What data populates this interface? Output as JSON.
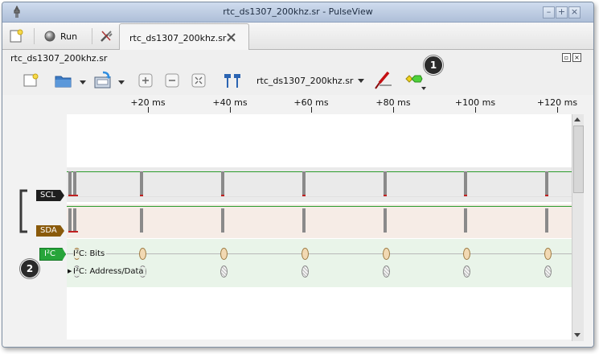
{
  "window": {
    "title": "rtc_ds1307_200khz.sr - PulseView"
  },
  "tabbar": {
    "run_label": "Run",
    "tab_label": "rtc_ds1307_200khz.sr"
  },
  "session": {
    "label": "rtc_ds1307_200khz.sr"
  },
  "toolbar": {
    "device_label": "rtc_ds1307_200khz.sr"
  },
  "ruler": {
    "ticks": [
      "+20 ms",
      "+40 ms",
      "+60 ms",
      "+80 ms",
      "+100 ms",
      "+120 ms"
    ]
  },
  "signals": {
    "scl": {
      "name": "SCL",
      "color": "#1e1e1e"
    },
    "sda": {
      "name": "SDA",
      "color": "#8a5a0b"
    },
    "decoder": {
      "name": "I²C",
      "color": "#27a53a"
    }
  },
  "decoder_rows": {
    "bits": "I²C: Bits",
    "address_data": "I²C: Address/Data"
  },
  "callouts": {
    "one": "1",
    "two": "2"
  },
  "icons": [
    "new-icon",
    "settings-icon",
    "close-icon",
    "open-icon",
    "save-icon",
    "zoom-in-icon",
    "zoom-out-icon",
    "zoom-fit-icon",
    "cursors-icon",
    "probe-icon",
    "decoder-icon"
  ]
}
